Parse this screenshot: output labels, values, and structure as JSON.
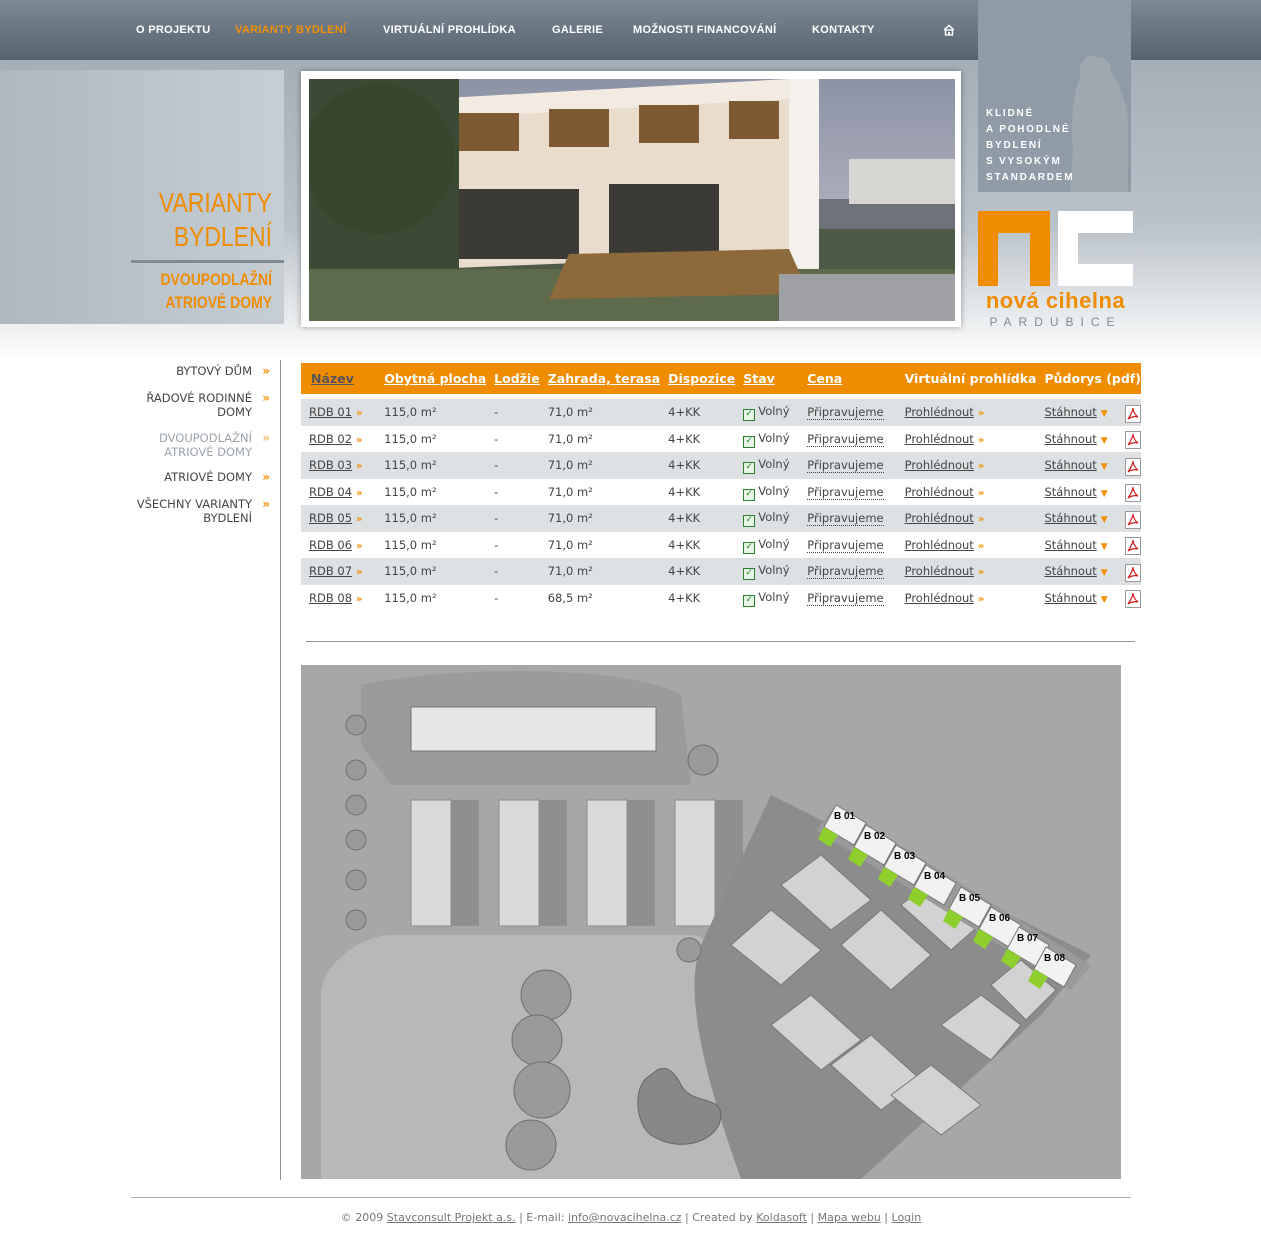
{
  "nav": {
    "items": [
      "O PROJEKTU",
      "VARIANTY BYDLENÍ",
      "VIRTUÁLNÍ PROHLÍDKA",
      "GALERIE",
      "MOŽNOSTI FINANCOVÁNÍ",
      "KONTAKTY"
    ],
    "active": "VARIANTY BYDLENÍ",
    "home_icon": "home-icon"
  },
  "heading": {
    "title_line1": "VARIANTY",
    "title_line2": "BYDLENÍ",
    "subtitle_line1": "DVOUPODLAŽNÍ",
    "subtitle_line2": "ATRIOVÉ DOMY"
  },
  "tagline": [
    "KLIDNÉ",
    "A POHODLNÉ",
    "BYDLENÍ",
    "S VYSOKÝM",
    "STANDARDEM"
  ],
  "logo": {
    "mark": "nc",
    "name": "nová cihelna",
    "city": "PARDUBICE"
  },
  "sidebar": {
    "items": [
      {
        "line1": "BYTOVÝ DŮM",
        "line2": ""
      },
      {
        "line1": "ŘADOVÉ RODINNÉ",
        "line2": "DOMY"
      },
      {
        "line1": "DVOUPODLAŽNÍ",
        "line2": "ATRIOVÉ DOMY"
      },
      {
        "line1": "ATRIOVÉ DOMY",
        "line2": ""
      },
      {
        "line1": "VŠECHNY VARIANTY",
        "line2": "BYDLENÍ"
      }
    ]
  },
  "table": {
    "headers": [
      "Název",
      "Obytná plocha",
      "Lodžie",
      "Zahrada, terasa",
      "Dispozice",
      "Stav",
      "Cena",
      "Virtuální prohlídka",
      "Půdorys (pdf)"
    ],
    "rows": [
      {
        "name": "RDB 01",
        "area": "115,0 m²",
        "loggia": "-",
        "garden": "71,0 m²",
        "layout": "4+KK",
        "status": "Volný",
        "price": "Připravujeme",
        "tour": "Prohlédnout",
        "plan": "Stáhnout"
      },
      {
        "name": "RDB 02",
        "area": "115,0 m²",
        "loggia": "-",
        "garden": "71,0 m²",
        "layout": "4+KK",
        "status": "Volný",
        "price": "Připravujeme",
        "tour": "Prohlédnout",
        "plan": "Stáhnout"
      },
      {
        "name": "RDB 03",
        "area": "115,0 m²",
        "loggia": "-",
        "garden": "71,0 m²",
        "layout": "4+KK",
        "status": "Volný",
        "price": "Připravujeme",
        "tour": "Prohlédnout",
        "plan": "Stáhnout"
      },
      {
        "name": "RDB 04",
        "area": "115,0 m²",
        "loggia": "-",
        "garden": "71,0 m²",
        "layout": "4+KK",
        "status": "Volný",
        "price": "Připravujeme",
        "tour": "Prohlédnout",
        "plan": "Stáhnout"
      },
      {
        "name": "RDB 05",
        "area": "115,0 m²",
        "loggia": "-",
        "garden": "71,0 m²",
        "layout": "4+KK",
        "status": "Volný",
        "price": "Připravujeme",
        "tour": "Prohlédnout",
        "plan": "Stáhnout"
      },
      {
        "name": "RDB 06",
        "area": "115,0 m²",
        "loggia": "-",
        "garden": "71,0 m²",
        "layout": "4+KK",
        "status": "Volný",
        "price": "Připravujeme",
        "tour": "Prohlédnout",
        "plan": "Stáhnout"
      },
      {
        "name": "RDB 07",
        "area": "115,0 m²",
        "loggia": "-",
        "garden": "71,0 m²",
        "layout": "4+KK",
        "status": "Volný",
        "price": "Připravujeme",
        "tour": "Prohlédnout",
        "plan": "Stáhnout"
      },
      {
        "name": "RDB 08",
        "area": "115,0 m²",
        "loggia": "-",
        "garden": "68,5 m²",
        "layout": "4+KK",
        "status": "Volný",
        "price": "Připravujeme",
        "tour": "Prohlédnout",
        "plan": "Stáhnout"
      }
    ]
  },
  "map": {
    "labels": [
      "B 01",
      "B 02",
      "B 03",
      "B 04",
      "B 05",
      "B 06",
      "B 07",
      "B 08"
    ]
  },
  "footer": {
    "copyright": "© 2009",
    "company": "Stavconsult Projekt a.s.",
    "email_label": "E-mail:",
    "email": "info@novacihelna.cz",
    "created_by": "Created by",
    "creator": "Koldasoft",
    "sitemap": "Mapa webu",
    "login": "Login"
  },
  "colors": {
    "accent": "#f08c00",
    "topbar": "#56636f",
    "row_alt": "#dde1e4",
    "lot_green": "#8ecf2e"
  }
}
